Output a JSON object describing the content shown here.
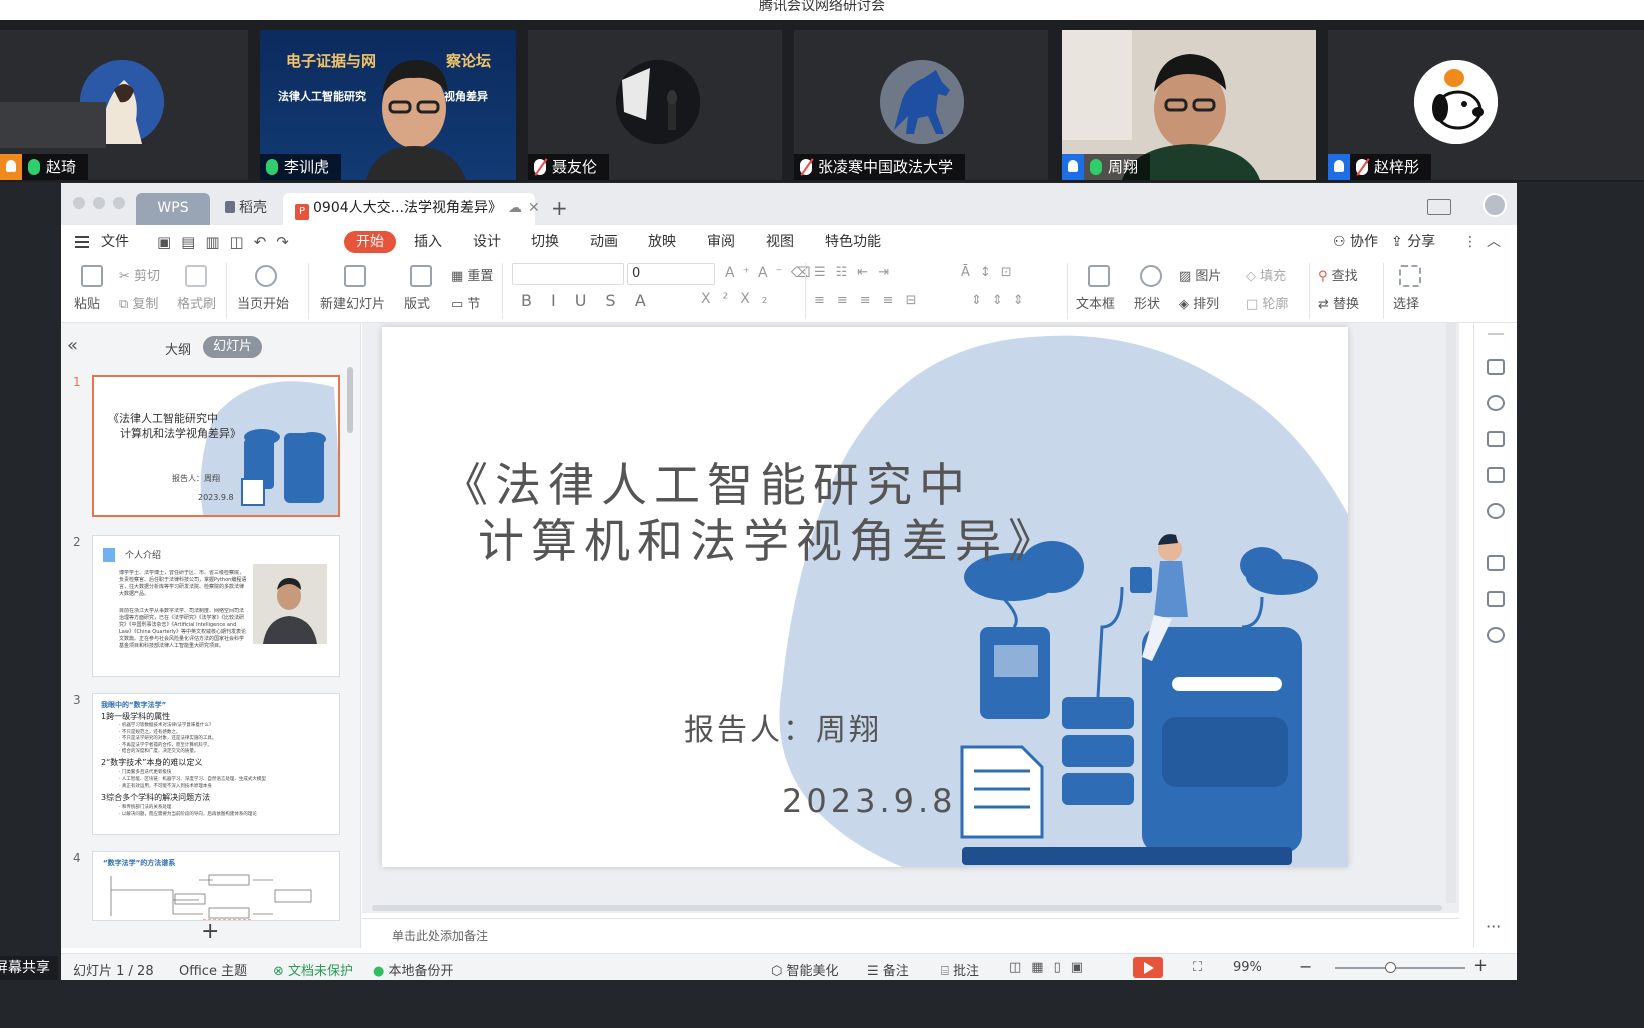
{
  "meeting": {
    "title": "腾讯会议网络研讨会",
    "participants": [
      {
        "name": "赵琦",
        "mic": "on"
      },
      {
        "name": "李训虎",
        "mic": "on"
      },
      {
        "name": "聂友伦",
        "mic": "muted"
      },
      {
        "name": "张凌寒中国政法大学",
        "mic": "muted"
      },
      {
        "name": "周翔",
        "mic": "on"
      },
      {
        "name": "赵梓彤",
        "mic": "muted"
      }
    ],
    "banner_line1": "电子证据与网",
    "banner_line1b": "察论坛",
    "banner_line2": "法律人工智能研究",
    "banner_line2b": "视角差异",
    "share_label": "屏幕共享"
  },
  "wps": {
    "tabs": {
      "wps": "WPS",
      "daoke": "稻壳",
      "doc": "0904人大交...法学视角差异》",
      "add": "+"
    },
    "menu": [
      "文件",
      "开始",
      "插入",
      "设计",
      "切换",
      "动画",
      "放映",
      "审阅",
      "视图",
      "特色功能"
    ],
    "menu_right": {
      "collab": "协作",
      "share": "分享"
    },
    "ribbon": {
      "paste": "粘贴",
      "cut": "剪切",
      "copy": "复制",
      "format_painter": "格式刷",
      "play_current": "当页开始",
      "new_slide": "新建幻灯片",
      "layout": "版式",
      "reset": "重置",
      "section": "节",
      "font_size": "0",
      "text_box": "文本框",
      "shape": "形状",
      "picture": "图片",
      "arrange": "排列",
      "fill": "填充",
      "outline": "轮廓",
      "find": "查找",
      "replace": "替换",
      "select": "选择"
    },
    "panel_tabs": {
      "outline": "大纲",
      "slides": "幻灯片"
    },
    "thumbs": [
      {
        "num": "1",
        "title1": "《法律人工智能研究中",
        "title2": "计算机和法学视角差异》",
        "author": "报告人：周翔",
        "date": "2023.9.8"
      },
      {
        "num": "2",
        "title": "个人介绍",
        "line1": "博学学士、法学博士，曾任研于区、市、省三级检察院，负责检察官、后任职于法律科技公司，掌握Python编程语言，往大数据分析库等学习研发法院、检察院的多款法律大数据产品。",
        "line2": "目前在浙江大学从事数字法学、司法制度、网络空间司法治理等方面研究，已在《法学研究》《法学家》《比较法研究》《中国刑事法杂志》《Artificial Intelligence and Law》《China Quarterly》等中英文权威核心期刊发表论文数篇。正在参与社会风险量化评估方法的国家社会科学基金项目和科技部法律人工智能重大研究项目。"
      },
      {
        "num": "3",
        "title": "我眼中的“数字法学”",
        "h1": "1跨一级学科的属性",
        "b1": "· 机器学习等数据技术对法律/法学意味着什么？",
        "b2": "· 不只是规范之，还有感数之。",
        "b3": "· 不只是法学研究的对象，还是法律实施的工具。",
        "b4": "· 不再是法学学者孤的合作，而至计算机科学。",
        "b5": "· 结合的深度和广度，决定交叉的质量。",
        "h2": "2“数字技术”本身的难以定义",
        "b6": "· 门类繁多且迭代更新极快",
        "b7": "· 人工智能、区块链：机器学习、深度学习、自然语言处理、生成式大模型",
        "b8": "· 真正有效运用，不可能不深入到技术原理本身",
        "h3": "3综合多个学科的解决问题方法",
        "b9": "· 和传统部门法的关系处理",
        "b10": "· 以解决问题，而应需要为当前阶段的导向，后再依图构建体系的理论"
      },
      {
        "num": "4",
        "title": "“数字法学”的方法谱系"
      }
    ],
    "slide": {
      "title_line1": "《法律人工智能研究中",
      "title_line2": "计算机和法学视角差异》",
      "author": "报告人：周翔",
      "date": "2023.9.8"
    },
    "notes_placeholder": "单击此处添加备注",
    "status": {
      "slide_info": "幻灯片 1 / 28",
      "theme": "Office 主题",
      "protect": "文档未保护",
      "backup": "本地备份开",
      "beautify": "智能美化",
      "notes": "备注",
      "comment": "批注",
      "zoom": "99%"
    }
  },
  "colors": {
    "accent": "#e8533c",
    "slide_blue": "#2e6db5",
    "blob": "#c9d7eb",
    "active_speaker": "#21c25f"
  }
}
